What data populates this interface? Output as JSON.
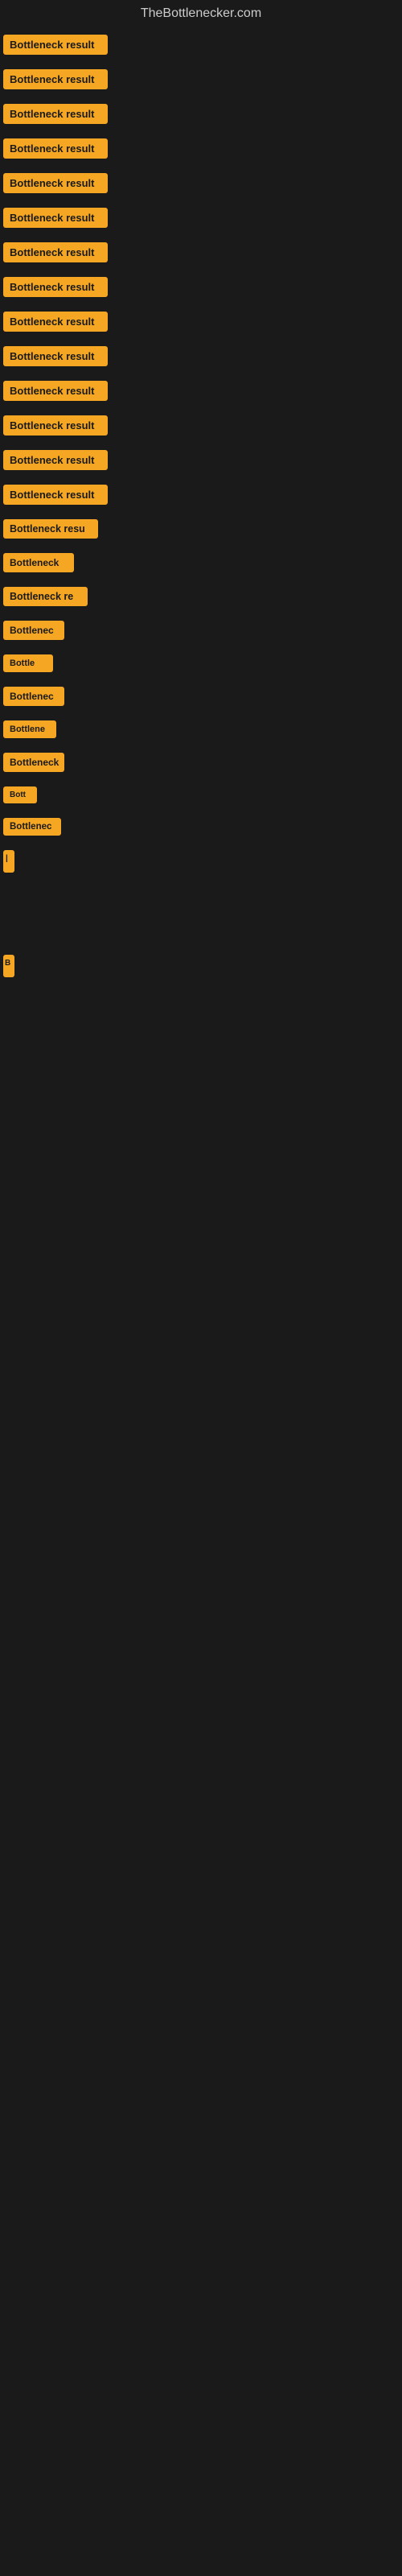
{
  "site": {
    "title": "TheBottlenecker.com"
  },
  "items": [
    {
      "id": 1,
      "label": "Bottleneck result"
    },
    {
      "id": 2,
      "label": "Bottleneck result"
    },
    {
      "id": 3,
      "label": "Bottleneck result"
    },
    {
      "id": 4,
      "label": "Bottleneck result"
    },
    {
      "id": 5,
      "label": "Bottleneck result"
    },
    {
      "id": 6,
      "label": "Bottleneck result"
    },
    {
      "id": 7,
      "label": "Bottleneck result"
    },
    {
      "id": 8,
      "label": "Bottleneck result"
    },
    {
      "id": 9,
      "label": "Bottleneck result"
    },
    {
      "id": 10,
      "label": "Bottleneck result"
    },
    {
      "id": 11,
      "label": "Bottleneck result"
    },
    {
      "id": 12,
      "label": "Bottleneck result"
    },
    {
      "id": 13,
      "label": "Bottleneck result"
    },
    {
      "id": 14,
      "label": "Bottleneck result"
    },
    {
      "id": 15,
      "label": "Bottleneck resu"
    },
    {
      "id": 16,
      "label": "Bottleneck"
    },
    {
      "id": 17,
      "label": "Bottleneck re"
    },
    {
      "id": 18,
      "label": "Bottlenec"
    },
    {
      "id": 19,
      "label": "Bottle"
    },
    {
      "id": 20,
      "label": "Bottlenec"
    },
    {
      "id": 21,
      "label": "Bottlene"
    },
    {
      "id": 22,
      "label": "Bottleneck"
    },
    {
      "id": 23,
      "label": "Bott"
    },
    {
      "id": 24,
      "label": "Bottlenec"
    },
    {
      "id": 25,
      "label": "|"
    },
    {
      "id": 26,
      "label": ""
    },
    {
      "id": 27,
      "label": ""
    },
    {
      "id": 28,
      "label": ""
    },
    {
      "id": 29,
      "label": "B"
    },
    {
      "id": 30,
      "label": ""
    },
    {
      "id": 31,
      "label": ""
    },
    {
      "id": 32,
      "label": ""
    },
    {
      "id": 33,
      "label": ""
    },
    {
      "id": 34,
      "label": ""
    },
    {
      "id": 35,
      "label": ""
    }
  ]
}
